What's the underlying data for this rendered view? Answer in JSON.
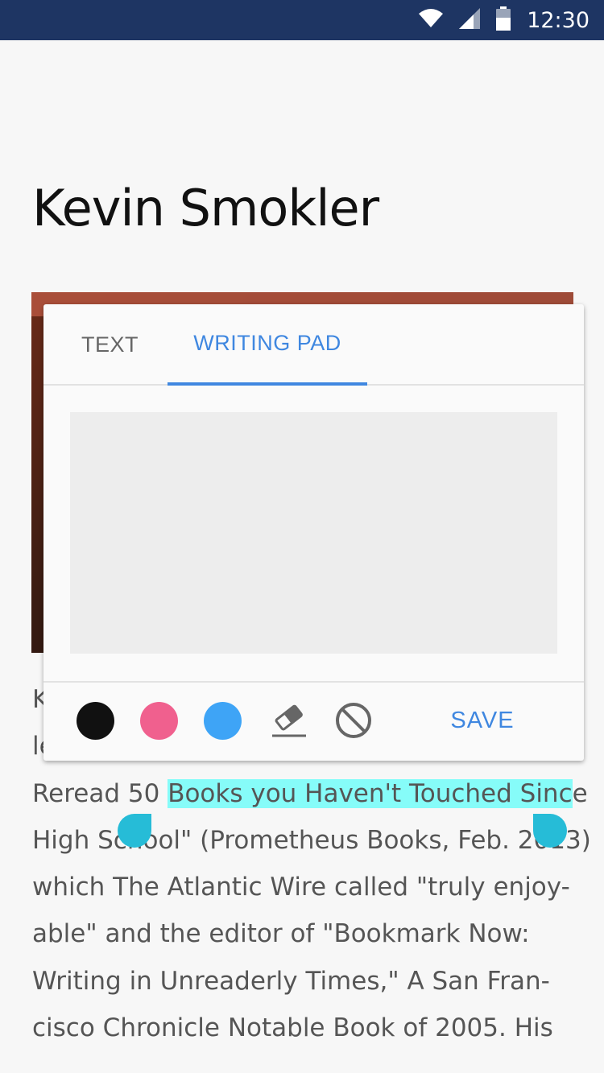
{
  "status_bar": {
    "time": "12:30",
    "icons": [
      "wifi-icon",
      "signal-icon",
      "battery-icon"
    ]
  },
  "page": {
    "title": "Kevin Smokler"
  },
  "article": {
    "line1_start": "Reread 50 ",
    "line1_highlight": "Books you Haven't Touched Sinc",
    "line1_end": "e",
    "line2": "High School\" (Prometheus Books, Feb. 2013)",
    "line3": "which The Atlantic Wire called \"truly enjoy-",
    "line4": "able\" and the editor of \"Bookmark Now:",
    "line5": "Writing in Unreaderly Times,\" A San Fran-",
    "line6": "cisco Chronicle Notable Book of 2005. His",
    "peek_k": "K",
    "peek_le": "le"
  },
  "popup": {
    "tabs": [
      {
        "label": "TEXT",
        "active": false
      },
      {
        "label": "WRITING PAD",
        "active": true
      }
    ],
    "colors": {
      "black": "#111111",
      "pink": "#f0608e",
      "blue": "#3ea4f6",
      "accent": "#3f87e0",
      "highlight": "#86fcf9",
      "selection_handle": "#26bcd7"
    },
    "tools": [
      "eraser-icon",
      "clear-icon"
    ],
    "save_label": "SAVE"
  }
}
